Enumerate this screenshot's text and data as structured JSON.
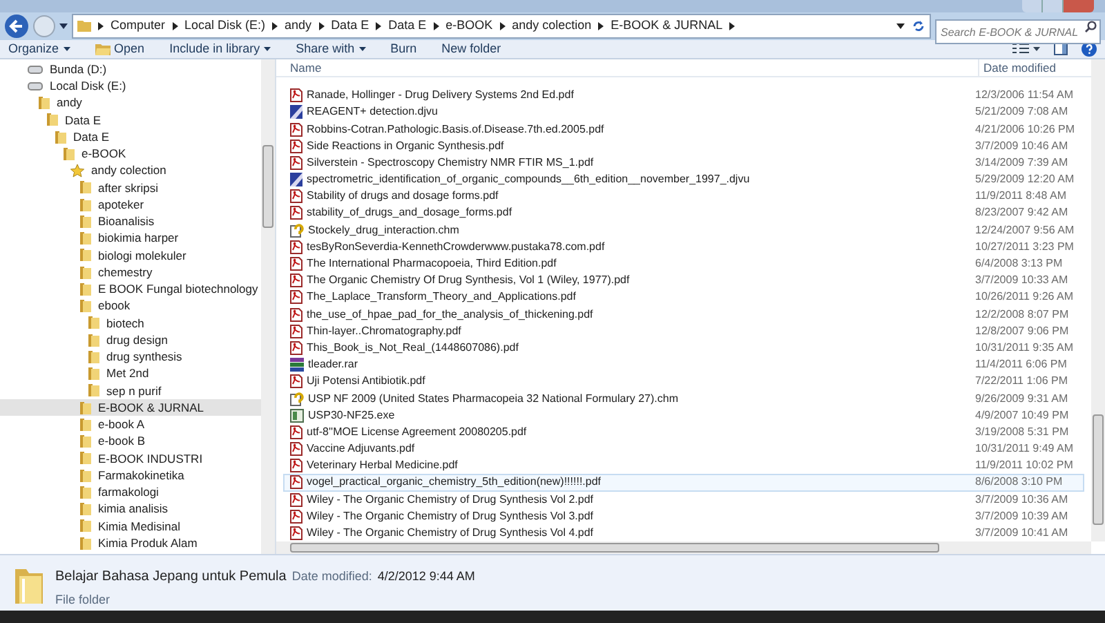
{
  "address_bar": {
    "breadcrumbs": [
      "Computer",
      "Local Disk (E:)",
      "andy",
      "Data E",
      "Data E",
      "e-BOOK",
      "andy colection",
      "E-BOOK & JURNAL"
    ]
  },
  "search": {
    "placeholder": "Search E-BOOK & JURNAL"
  },
  "toolbar": [
    {
      "label": "Organize",
      "kind": "menu"
    },
    {
      "label": "Open",
      "kind": "icon"
    },
    {
      "label": "Include in library",
      "kind": "menu"
    },
    {
      "label": "Share with",
      "kind": "menu"
    },
    {
      "label": "Burn",
      "kind": "plain"
    },
    {
      "label": "New folder",
      "kind": "plain"
    }
  ],
  "nav_tree": [
    {
      "label": "Bunda (D:)",
      "kind": "drive",
      "selected": false
    },
    {
      "label": "Local Disk (E:)",
      "kind": "drive",
      "selected": false,
      "children": [
        {
          "label": "andy",
          "kind": "folder",
          "selected": false,
          "children": [
            {
              "label": "Data E",
              "kind": "folder",
              "selected": false,
              "children": [
                {
                  "label": "Data E",
                  "kind": "folder",
                  "selected": false,
                  "children": [
                    {
                      "label": "e-BOOK",
                      "kind": "folder",
                      "selected": false,
                      "children": [
                        {
                          "label": "andy colection",
                          "kind": "favorite",
                          "selected": false,
                          "children": [
                            {
                              "label": "after skripsi",
                              "kind": "folder",
                              "selected": false
                            },
                            {
                              "label": "apoteker",
                              "kind": "folder",
                              "selected": false
                            },
                            {
                              "label": "Bioanalisis",
                              "kind": "folder",
                              "selected": false
                            },
                            {
                              "label": "biokimia harper",
                              "kind": "folder",
                              "selected": false
                            },
                            {
                              "label": "biologi molekuler",
                              "kind": "folder",
                              "selected": false
                            },
                            {
                              "label": "chemestry",
                              "kind": "folder",
                              "selected": false
                            },
                            {
                              "label": "E BOOK Fungal biotechnology",
                              "kind": "folder",
                              "selected": false
                            },
                            {
                              "label": "ebook",
                              "kind": "folder",
                              "selected": false,
                              "children": [
                                {
                                  "label": "biotech",
                                  "kind": "folder",
                                  "selected": false
                                },
                                {
                                  "label": "drug design",
                                  "kind": "folder",
                                  "selected": false
                                },
                                {
                                  "label": "drug synthesis",
                                  "kind": "folder",
                                  "selected": false
                                },
                                {
                                  "label": "Met 2nd",
                                  "kind": "folder",
                                  "selected": false
                                },
                                {
                                  "label": "sep n purif",
                                  "kind": "folder",
                                  "selected": false
                                }
                              ]
                            },
                            {
                              "label": "E-BOOK & JURNAL",
                              "kind": "folder",
                              "selected": true
                            },
                            {
                              "label": "e-book A",
                              "kind": "folder",
                              "selected": false
                            },
                            {
                              "label": "e-book B",
                              "kind": "folder",
                              "selected": false
                            },
                            {
                              "label": "E-BOOK INDUSTRI",
                              "kind": "folder",
                              "selected": false
                            },
                            {
                              "label": "Farmakokinetika",
                              "kind": "folder",
                              "selected": false
                            },
                            {
                              "label": "farmakologi",
                              "kind": "folder",
                              "selected": false
                            },
                            {
                              "label": "kimia analisis",
                              "kind": "folder",
                              "selected": false
                            },
                            {
                              "label": "Kimia Medisinal",
                              "kind": "folder",
                              "selected": false
                            },
                            {
                              "label": "Kimia Produk Alam",
                              "kind": "folder",
                              "selected": false
                            }
                          ]
                        }
                      ]
                    }
                  ]
                }
              ]
            }
          ]
        }
      ]
    }
  ],
  "file_list": {
    "columns": [
      "Name",
      "Date modified"
    ],
    "rows": [
      {
        "name": "Ranade, Hollinger - Drug Delivery Systems 2nd Ed.pdf",
        "date": "12/3/2006 11:54 AM",
        "kind": "pdf",
        "highlighted": false
      },
      {
        "name": "REAGENT+ detection.djvu",
        "date": "5/21/2009 7:08 AM",
        "kind": "djvu",
        "highlighted": false
      },
      {
        "name": "Robbins-Cotran.Pathologic.Basis.of.Disease.7th.ed.2005.pdf",
        "date": "4/21/2006 10:26 PM",
        "kind": "pdf",
        "highlighted": false
      },
      {
        "name": "Side Reactions in Organic Synthesis.pdf",
        "date": "3/7/2009 10:46 AM",
        "kind": "pdf",
        "highlighted": false
      },
      {
        "name": "Silverstein - Spectroscopy Chemistry NMR FTIR MS_1.pdf",
        "date": "3/14/2009 7:39 AM",
        "kind": "pdf",
        "highlighted": false
      },
      {
        "name": "spectrometric_identification_of_organic_compounds__6th_edition__november_1997_.djvu",
        "date": "5/29/2009 12:20 AM",
        "kind": "djvu",
        "highlighted": false
      },
      {
        "name": "Stability of drugs and dosage forms.pdf",
        "date": "11/9/2011 8:48 AM",
        "kind": "pdf",
        "highlighted": false
      },
      {
        "name": "stability_of_drugs_and_dosage_forms.pdf",
        "date": "8/23/2007 9:42 AM",
        "kind": "pdf",
        "highlighted": false
      },
      {
        "name": "Stockely_drug_interaction.chm",
        "date": "12/24/2007 9:56 AM",
        "kind": "chm",
        "highlighted": false
      },
      {
        "name": "tesByRonSeverdia-KennethCrowderwww.pustaka78.com.pdf",
        "date": "10/27/2011 3:23 PM",
        "kind": "pdf",
        "highlighted": false
      },
      {
        "name": "The International Pharmacopoeia, Third Edition.pdf",
        "date": "6/4/2008 3:13 PM",
        "kind": "pdf",
        "highlighted": false
      },
      {
        "name": "The Organic Chemistry Of Drug Synthesis, Vol 1 (Wiley, 1977).pdf",
        "date": "3/7/2009 10:33 AM",
        "kind": "pdf",
        "highlighted": false
      },
      {
        "name": "The_Laplace_Transform_Theory_and_Applications.pdf",
        "date": "10/26/2011 9:26 AM",
        "kind": "pdf",
        "highlighted": false
      },
      {
        "name": "the_use_of_hpae_pad_for_the_analysis_of_thickening.pdf",
        "date": "12/2/2008 8:07 PM",
        "kind": "pdf",
        "highlighted": false
      },
      {
        "name": "Thin-layer..Chromatography.pdf",
        "date": "12/8/2007 9:06 PM",
        "kind": "pdf",
        "highlighted": false
      },
      {
        "name": "This_Book_is_Not_Real_(1448607086).pdf",
        "date": "10/31/2011 9:35 AM",
        "kind": "pdf",
        "highlighted": false
      },
      {
        "name": "tleader.rar",
        "date": "11/4/2011 6:06 PM",
        "kind": "rar",
        "highlighted": false
      },
      {
        "name": "Uji Potensi Antibiotik.pdf",
        "date": "7/22/2011 1:06 PM",
        "kind": "pdf",
        "highlighted": false
      },
      {
        "name": "USP NF 2009 (United States Pharmacopeia 32  National Formulary 27).chm",
        "date": "9/26/2009 9:31 AM",
        "kind": "chm",
        "highlighted": false
      },
      {
        "name": "USP30-NF25.exe",
        "date": "4/9/2007 10:49 PM",
        "kind": "exe",
        "highlighted": false
      },
      {
        "name": "utf-8''MOE License Agreement 20080205.pdf",
        "date": "3/19/2008 5:31 PM",
        "kind": "pdf",
        "highlighted": false
      },
      {
        "name": "Vaccine Adjuvants.pdf",
        "date": "10/31/2011 9:49 AM",
        "kind": "pdf",
        "highlighted": false
      },
      {
        "name": "Veterinary Herbal Medicine.pdf",
        "date": "11/9/2011 10:02 PM",
        "kind": "pdf",
        "highlighted": false
      },
      {
        "name": "vogel_practical_organic_chemistry_5th_edition(new)!!!!!!.pdf",
        "date": "8/6/2008 3:10 PM",
        "kind": "pdf",
        "highlighted": true
      },
      {
        "name": "Wiley - The Organic Chemistry of Drug Synthesis Vol 2.pdf",
        "date": "3/7/2009 10:36 AM",
        "kind": "pdf",
        "highlighted": false
      },
      {
        "name": "Wiley - The Organic Chemistry of Drug Synthesis Vol 3.pdf",
        "date": "3/7/2009 10:39 AM",
        "kind": "pdf",
        "highlighted": false
      },
      {
        "name": "Wiley - The Organic Chemistry of Drug Synthesis Vol 4.pdf",
        "date": "3/7/2009 10:41 AM",
        "kind": "pdf",
        "highlighted": false
      }
    ]
  },
  "details_pane": {
    "name": "Belajar Bahasa Jepang untuk Pemula",
    "date_label": "Date modified:",
    "date": "4/2/2012 9:44 AM",
    "type": "File folder"
  }
}
